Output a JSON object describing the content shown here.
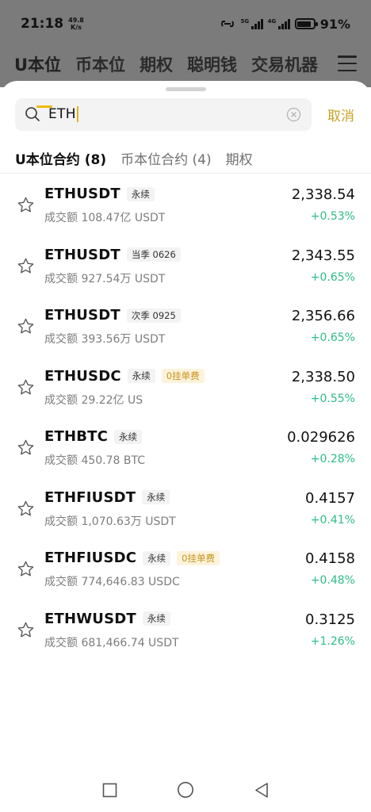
{
  "status": {
    "time": "21:18",
    "speed_value": "49.8",
    "speed_unit": "K/s",
    "net_a": "5G",
    "net_b": "4G",
    "battery": "91%"
  },
  "background_tabs": [
    "U本位",
    "币本位",
    "期权",
    "聪明钱",
    "交易机器"
  ],
  "search": {
    "value": "ETH",
    "cancel_label": "取消"
  },
  "category_tabs": [
    {
      "label": "U本位合约 (8)",
      "active": true
    },
    {
      "label": "币本位合约 (4)",
      "active": false
    },
    {
      "label": "期权",
      "active": false
    }
  ],
  "results": [
    {
      "symbol": "ETHUSDT",
      "tag": "永续",
      "promo": "",
      "volume": "成交额 108.47亿 USDT",
      "price": "2,338.54",
      "change": "+0.53%"
    },
    {
      "symbol": "ETHUSDT",
      "tag": "当季 0626",
      "promo": "",
      "volume": "成交额 927.54万 USDT",
      "price": "2,343.55",
      "change": "+0.65%"
    },
    {
      "symbol": "ETHUSDT",
      "tag": "次季 0925",
      "promo": "",
      "volume": "成交额 393.56万 USDT",
      "price": "2,356.66",
      "change": "+0.65%"
    },
    {
      "symbol": "ETHUSDC",
      "tag": "永续",
      "promo": "0挂单费",
      "volume": "成交额 29.22亿 US",
      "price": "2,338.50",
      "change": "+0.55%"
    },
    {
      "symbol": "ETHBTC",
      "tag": "永续",
      "promo": "",
      "volume": "成交额 450.78 BTC",
      "price": "0.029626",
      "change": "+0.28%"
    },
    {
      "symbol": "ETHFIUSDT",
      "tag": "永续",
      "promo": "",
      "volume": "成交额 1,070.63万 USDT",
      "price": "0.4157",
      "change": "+0.41%"
    },
    {
      "symbol": "ETHFIUSDC",
      "tag": "永续",
      "promo": "0挂单费",
      "volume": "成交额 774,646.83 USDC",
      "price": "0.4158",
      "change": "+0.48%"
    },
    {
      "symbol": "ETHWUSDT",
      "tag": "永续",
      "promo": "",
      "volume": "成交额 681,466.74 USDT",
      "price": "0.3125",
      "change": "+1.26%"
    }
  ],
  "icons": {
    "search": "search-icon",
    "clear": "clear-circle-icon",
    "star": "star-outline-icon",
    "menu": "hamburger-menu-icon",
    "nav": [
      "square-recents-icon",
      "circle-home-icon",
      "triangle-back-icon"
    ]
  },
  "colors": {
    "accent": "#f0b90b",
    "cancel": "#c9a227",
    "up": "#2ebd85",
    "promo_text": "#c9921a",
    "promo_bg": "#fdf3dc"
  }
}
